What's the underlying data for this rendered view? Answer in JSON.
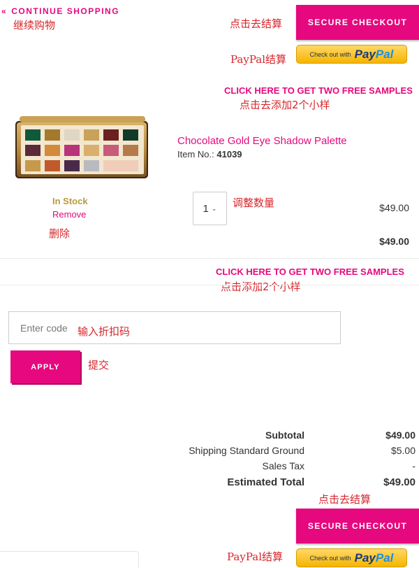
{
  "header": {
    "continue_chevron": "«",
    "continue_label": "CONTINUE SHOPPING",
    "secure_checkout": "SECURE CHECKOUT",
    "paypal_prefix": "Check out with",
    "paypal_brand_1": "Pay",
    "paypal_brand_2": "Pal"
  },
  "annotations": {
    "continue": "继续购物",
    "checkout_top": "点击去结算",
    "paypal_top": "PayPal结算",
    "samples_top": "点击去添加2个小样",
    "quantity": "调整数量",
    "remove": "删除",
    "samples_mid": "点击添加2个小样",
    "code": "输入折扣码",
    "apply": "提交",
    "checkout_bottom": "点击去结算",
    "paypal_bottom": "PayPal结算"
  },
  "samples_link": "CLICK HERE TO GET TWO FREE SAMPLES",
  "product": {
    "name": "Chocolate Gold Eye Shadow Palette",
    "item_label": "Item No.:",
    "item_number": "41039",
    "stock": "In Stock",
    "remove": "Remove",
    "quantity": "1",
    "unit_price": "$49.00",
    "line_total": "$49.00"
  },
  "promo": {
    "placeholder": "Enter code",
    "apply": "APPLY"
  },
  "summary": {
    "subtotal_label": "Subtotal",
    "subtotal_value": "$49.00",
    "shipping_label": "Shipping Standard Ground",
    "shipping_value": "$5.00",
    "tax_label": "Sales Tax",
    "tax_value": "-",
    "total_label": "Estimated Total",
    "total_value": "$49.00"
  },
  "colors": {
    "brand_pink": "#e6087e",
    "annotation_red": "#d6262b",
    "stock_gold": "#b89a3e",
    "paypal_yellow": "#f5b400"
  }
}
